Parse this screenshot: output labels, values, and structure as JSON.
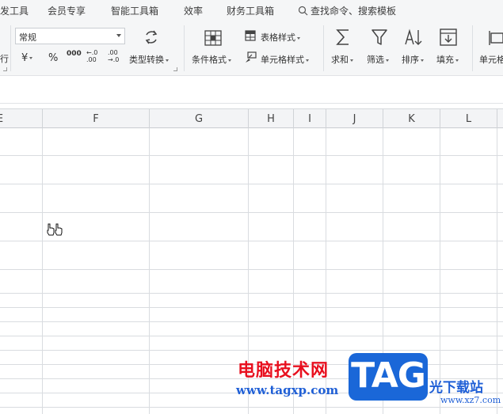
{
  "menu": {
    "tabs": [
      "发工具",
      "会员专享",
      "智能工具箱",
      "效率",
      "财务工具箱"
    ],
    "search_label": "查找命令、搜索模板"
  },
  "ribbon": {
    "number_format_value": "常规",
    "currency_symbol": "¥",
    "percent_symbol": "%",
    "thousands_symbol": "000",
    "inc_decimal_symbol": "←.0 .00",
    "dec_decimal_symbol": ".00 →.0",
    "left_edge_label": "行",
    "type_convert_label": "类型转换",
    "conditional_format_label": "条件格式",
    "table_style_label": "表格样式",
    "cell_style_label": "单元格样式",
    "sum_label": "求和",
    "filter_label": "筛选",
    "sort_label": "排序",
    "fill_label": "填充",
    "cell_label": "单元格"
  },
  "sheet": {
    "columns": [
      "E",
      "F",
      "G",
      "H",
      "I",
      "J",
      "K",
      "L"
    ]
  },
  "watermark": {
    "site_name": "电脑技术网",
    "url": "www.tagxp.com",
    "logo": "TAG",
    "right_text": "光下载站",
    "right_url": "www.xz7.com"
  }
}
